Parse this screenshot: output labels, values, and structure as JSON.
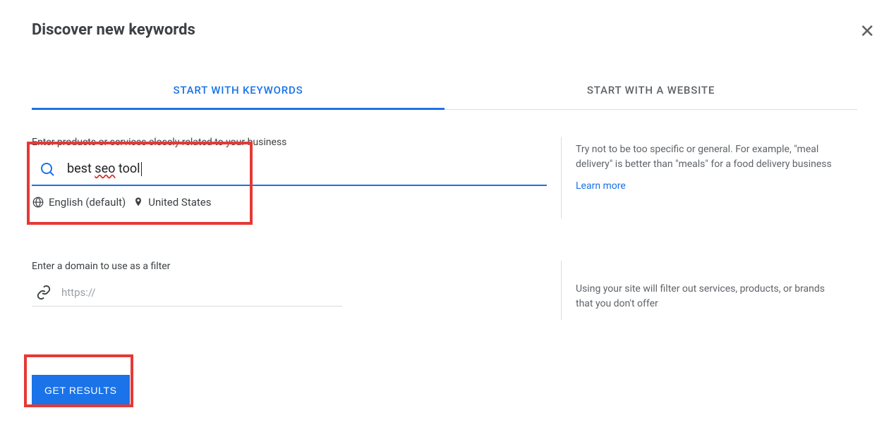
{
  "header": {
    "title": "Discover new keywords"
  },
  "tabs": {
    "keywords": "START WITH KEYWORDS",
    "website": "START WITH A WEBSITE"
  },
  "section1": {
    "label": "Enter products or services closely related to your business",
    "input_prefix": "best ",
    "input_spelled": "seo",
    "input_suffix": " tool",
    "language": "English (default)",
    "location": "United States",
    "help_text": "Try not to be too specific or general. For example, \"meal delivery\" is better than \"meals\" for a food delivery business",
    "learn_more": "Learn more"
  },
  "section2": {
    "label": "Enter a domain to use as a filter",
    "placeholder": "https://",
    "help_text": "Using your site will filter out services, products, or brands that you don't offer"
  },
  "cta": {
    "get_results": "GET RESULTS"
  }
}
